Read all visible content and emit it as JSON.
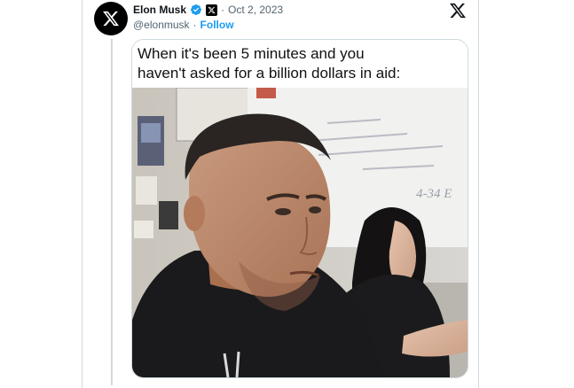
{
  "tweet": {
    "author_name": "Elon Musk",
    "separator": "·",
    "date": "Oct 2, 2023",
    "handle": "@elonmusk",
    "handle_separator": "·",
    "follow_label": "Follow"
  },
  "media": {
    "caption": "When it's been 5 minutes and you\nhaven't asked for a billion dollars in aid:",
    "whiteboard_text": "4-34 E"
  },
  "icons": {
    "avatar": "x-logo-icon",
    "verified": "verified-badge-icon",
    "affiliation": "x-affiliate-badge-icon",
    "brand": "x-logo-icon"
  },
  "colors": {
    "accent": "#1d9bf0",
    "text": "#0f1419",
    "secondary": "#536471",
    "border": "#cfd9de"
  }
}
